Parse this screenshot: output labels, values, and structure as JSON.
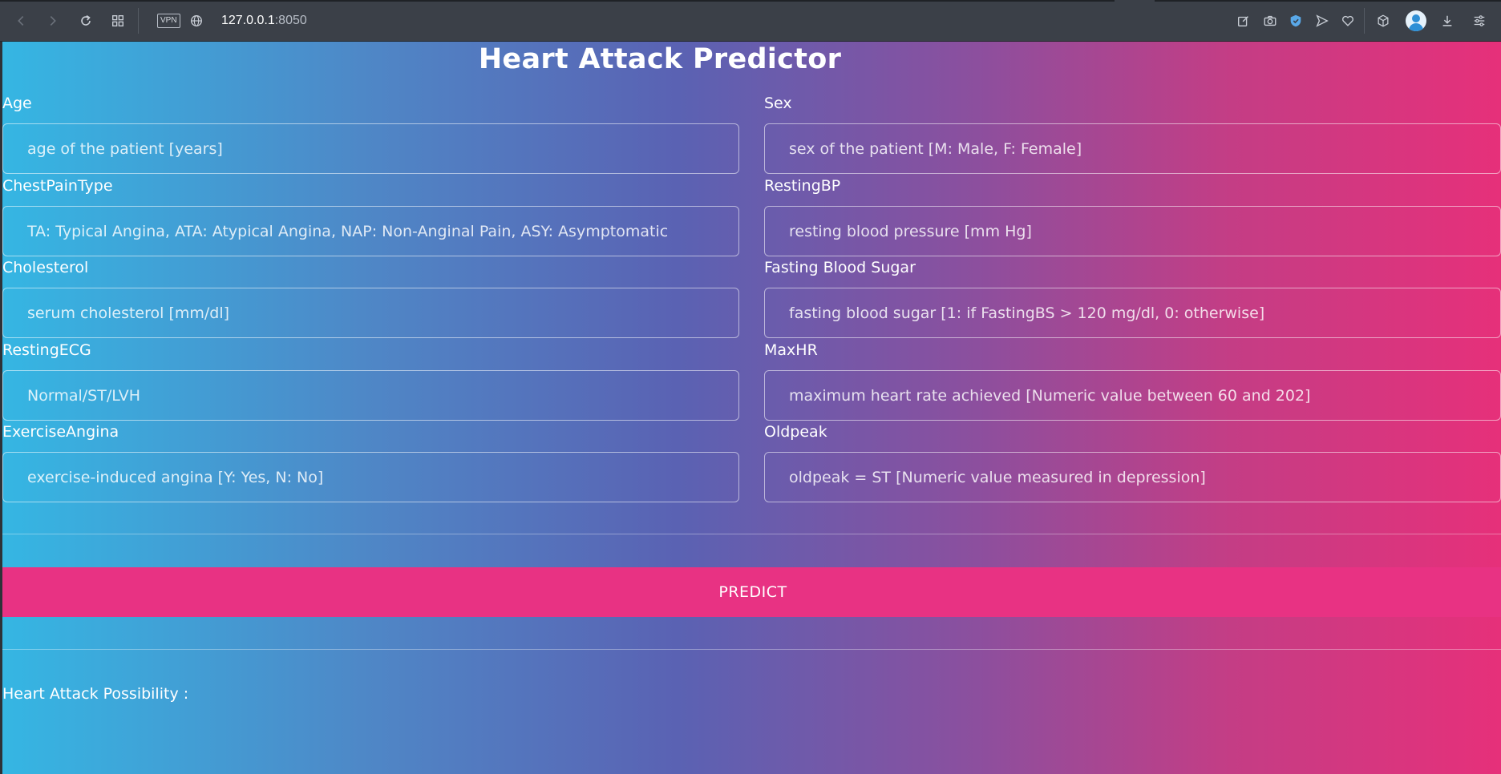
{
  "browser": {
    "vpn_label": "VPN",
    "url_host": "127.0.0.1",
    "url_port": ":8050"
  },
  "page": {
    "title": "Heart Attack Predictor",
    "fields": [
      {
        "label": "Age",
        "placeholder": "age of the patient [years]"
      },
      {
        "label": "Sex",
        "placeholder": "sex of the patient [M: Male, F: Female]"
      },
      {
        "label": "ChestPainType",
        "placeholder": "TA: Typical Angina, ATA: Atypical Angina, NAP: Non-Anginal Pain, ASY: Asymptomatic"
      },
      {
        "label": "RestingBP",
        "placeholder": "resting blood pressure [mm Hg]"
      },
      {
        "label": "Cholesterol",
        "placeholder": "serum cholesterol [mm/dl]"
      },
      {
        "label": "Fasting Blood Sugar",
        "placeholder": "fasting blood sugar [1: if FastingBS > 120 mg/dl, 0: otherwise]"
      },
      {
        "label": "RestingECG",
        "placeholder": "Normal/ST/LVH"
      },
      {
        "label": "MaxHR",
        "placeholder": "maximum heart rate achieved [Numeric value between 60 and 202]"
      },
      {
        "label": "ExerciseAngina",
        "placeholder": "exercise-induced angina [Y: Yes, N: No]"
      },
      {
        "label": "Oldpeak",
        "placeholder": "oldpeak = ST [Numeric value measured in depression]"
      }
    ],
    "predict_label": "PREDICT",
    "result_label": "Heart Attack Possibility :"
  }
}
